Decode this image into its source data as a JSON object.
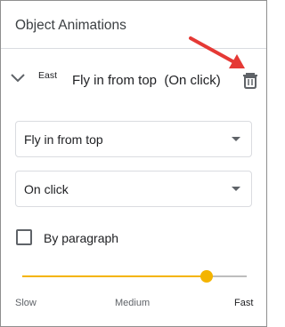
{
  "panel": {
    "title": "Object Animations"
  },
  "animation_item": {
    "object_name": "East",
    "summary": "Fly in from top  (On click)"
  },
  "effect_select": {
    "value": "Fly in from top"
  },
  "trigger_select": {
    "value": "On click"
  },
  "by_paragraph": {
    "label": "By paragraph",
    "checked": false
  },
  "speed_slider": {
    "level": 0.82,
    "labels": {
      "slow": "Slow",
      "medium": "Medium",
      "fast": "Fast"
    }
  },
  "icons": {
    "collapse": "chevron-down-icon",
    "delete": "trash-icon",
    "dropdown": "caret-down-icon",
    "annotation": "red-arrow"
  },
  "colors": {
    "accent": "#f4b400",
    "annotation_arrow": "#e53935",
    "divider": "#dadce0",
    "icon": "#5f6368"
  }
}
